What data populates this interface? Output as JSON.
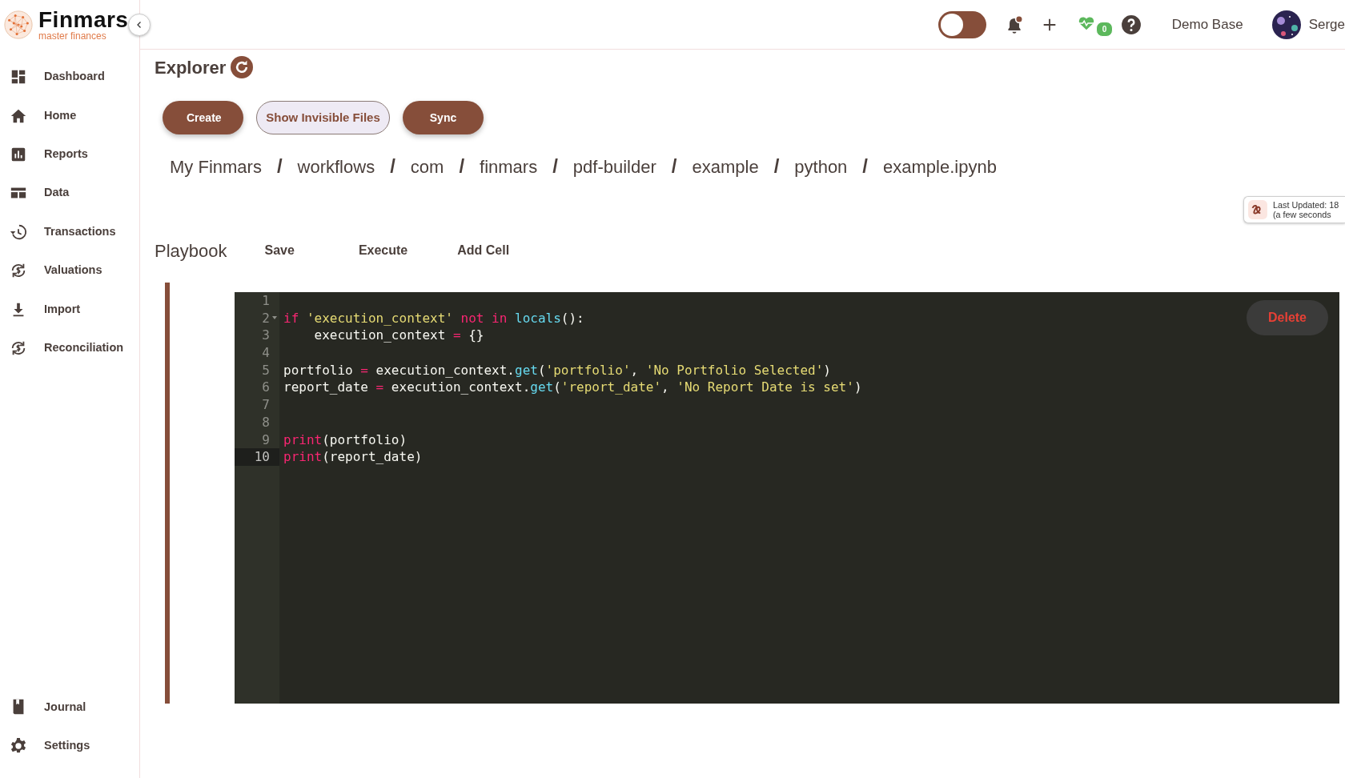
{
  "brand": {
    "name": "Finmars",
    "tagline": "master finances"
  },
  "sidebar": {
    "items": [
      {
        "label": "Dashboard"
      },
      {
        "label": "Home"
      },
      {
        "label": "Reports"
      },
      {
        "label": "Data"
      },
      {
        "label": "Transactions"
      },
      {
        "label": "Valuations"
      },
      {
        "label": "Import"
      },
      {
        "label": "Reconciliation"
      }
    ],
    "bottom_items": [
      {
        "label": "Journal"
      },
      {
        "label": "Settings"
      }
    ]
  },
  "header": {
    "theme_toggle": {
      "on": false
    },
    "notifications": {
      "unread": true
    },
    "health": {
      "count": "0"
    },
    "base": "Demo Base",
    "user": "Serge"
  },
  "page": {
    "title": "Explorer",
    "buttons": [
      {
        "label": "Create",
        "kind": "filled"
      },
      {
        "label": "Show Invisible Files",
        "kind": "outline"
      },
      {
        "label": "Sync",
        "kind": "filled"
      }
    ],
    "breadcrumb": [
      {
        "kind": "link",
        "text": "My Finmars"
      },
      {
        "kind": "separator",
        "text": "/"
      },
      {
        "kind": "link",
        "text": "workflows"
      },
      {
        "kind": "separator",
        "text": "/"
      },
      {
        "kind": "link",
        "text": "com"
      },
      {
        "kind": "separator",
        "text": "/"
      },
      {
        "kind": "link",
        "text": "finmars"
      },
      {
        "kind": "separator",
        "text": "/"
      },
      {
        "kind": "link",
        "text": "pdf-builder"
      },
      {
        "kind": "separator",
        "text": "/"
      },
      {
        "kind": "link",
        "text": "example"
      },
      {
        "kind": "separator",
        "text": "/"
      },
      {
        "kind": "link",
        "text": "python"
      },
      {
        "kind": "separator",
        "text": "/"
      },
      {
        "kind": "link",
        "text": "example.ipynb"
      }
    ],
    "last_updated": {
      "line1": "Last Updated: 18",
      "line2": "(a few seconds"
    }
  },
  "playbook": {
    "title": "Playbook",
    "actions": [
      "Save",
      "Execute",
      "Add Cell"
    ],
    "cell": {
      "delete": "Delete",
      "lines": [
        {
          "number": "1",
          "active": false,
          "foldable": false
        },
        {
          "number": "2",
          "active": false,
          "foldable": true,
          "tokens": [
            {
              "kind": "keyword",
              "text": "if "
            },
            {
              "kind": "string",
              "text": "'execution_context' "
            },
            {
              "kind": "keyword",
              "text": "not in "
            },
            {
              "kind": "func",
              "text": "locals"
            },
            {
              "kind": "plain",
              "text": "():"
            }
          ]
        },
        {
          "number": "3",
          "active": false,
          "foldable": false,
          "tokens": [
            {
              "kind": "plain",
              "text": "    execution_context "
            },
            {
              "kind": "keyword",
              "text": "="
            },
            {
              "kind": "plain",
              "text": " {}"
            }
          ]
        },
        {
          "number": "4",
          "active": false,
          "foldable": false
        },
        {
          "number": "5",
          "active": false,
          "foldable": false,
          "tokens": [
            {
              "kind": "plain",
              "text": "portfolio "
            },
            {
              "kind": "keyword",
              "text": "="
            },
            {
              "kind": "plain",
              "text": " execution_context."
            },
            {
              "kind": "func",
              "text": "get"
            },
            {
              "kind": "plain",
              "text": "("
            },
            {
              "kind": "string",
              "text": "'portfolio'"
            },
            {
              "kind": "plain",
              "text": ", "
            },
            {
              "kind": "string",
              "text": "'No Portfolio Selected'"
            },
            {
              "kind": "plain",
              "text": ")"
            }
          ]
        },
        {
          "number": "6",
          "active": false,
          "foldable": false,
          "tokens": [
            {
              "kind": "plain",
              "text": "report_date "
            },
            {
              "kind": "keyword",
              "text": "="
            },
            {
              "kind": "plain",
              "text": " execution_context."
            },
            {
              "kind": "func",
              "text": "get"
            },
            {
              "kind": "plain",
              "text": "("
            },
            {
              "kind": "string",
              "text": "'report_date'"
            },
            {
              "kind": "plain",
              "text": ", "
            },
            {
              "kind": "string",
              "text": "'No Report Date is set'"
            },
            {
              "kind": "plain",
              "text": ")"
            }
          ]
        },
        {
          "number": "7",
          "active": false,
          "foldable": false
        },
        {
          "number": "8",
          "active": false,
          "foldable": false
        },
        {
          "number": "9",
          "active": false,
          "foldable": false,
          "tokens": [
            {
              "kind": "keyword",
              "text": "print"
            },
            {
              "kind": "plain",
              "text": "(portfolio)"
            }
          ]
        },
        {
          "number": "10",
          "active": true,
          "foldable": false,
          "tokens": [
            {
              "kind": "keyword",
              "text": "print"
            },
            {
              "kind": "plain",
              "text": "(report_date)"
            }
          ]
        }
      ]
    }
  }
}
